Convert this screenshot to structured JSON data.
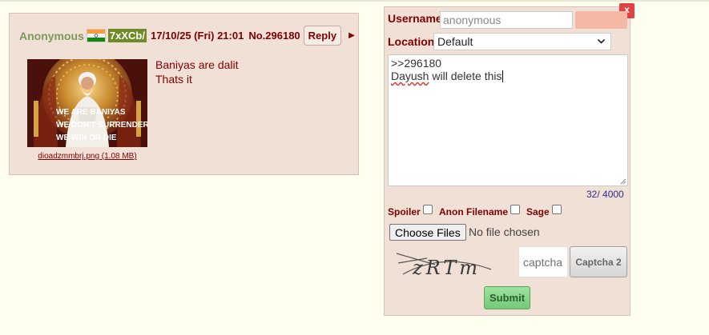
{
  "post": {
    "name": "Anonymous",
    "flag_icon": "india-flag-icon",
    "poster_id": "7xXCb/",
    "date": "17/10/25 (Fri) 21:01",
    "number": "No.296180",
    "reply_label": "Reply",
    "menu_icon": "triangle-right-icon",
    "thumbnail": {
      "icon": "thumbnail-image",
      "lines": [
        "WE ARE BANIYAS",
        "WE DON'T SURRENDER",
        "WE WIN OR DIE"
      ]
    },
    "file_link": "dioadzmmbrj.png (1.08 MB)",
    "message_lines": [
      "Baniyas are dalit",
      "Thats it"
    ]
  },
  "quick_reply": {
    "close_label": "x",
    "username_label": "Username",
    "username_placeholder": "anonymous",
    "location_label": "Location",
    "location_value": "Default",
    "comment_line1": ">>296180",
    "comment_word_misspelled": "Dayush",
    "comment_rest": " will delete this",
    "char_count": "32/ 4000",
    "spoiler_label": "Spoiler",
    "anon_filename_label": "Anon Filename",
    "sage_label": "Sage",
    "choose_files_label": "Choose Files",
    "file_status": "No file chosen",
    "captcha_text": "zRTm",
    "captcha_placeholder": "captcha",
    "captcha_button_label": "Captcha 2",
    "submit_label": "Submit"
  },
  "colors": {
    "background": "#ffffee",
    "post_background": "#f0e0d6",
    "name": "#7a9a5a",
    "text": "#800000",
    "id_badge": "#708a28",
    "close": "#e04343",
    "submit": "#8bd68e"
  }
}
